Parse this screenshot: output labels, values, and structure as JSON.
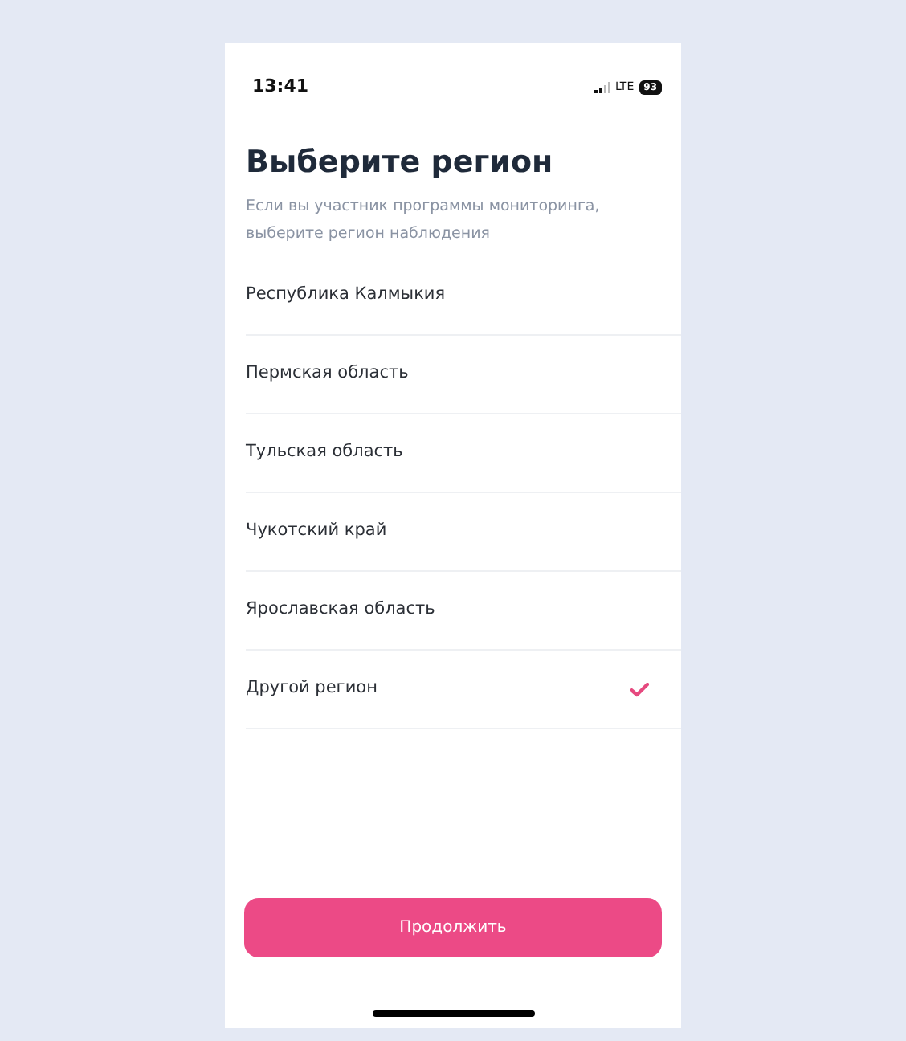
{
  "status_bar": {
    "time": "13:41",
    "network": "LTE",
    "battery": "93"
  },
  "title": "Выберите регион",
  "subtitle": "Если вы участник программы мониторинга, выберите регион наблюдения",
  "regions": [
    {
      "label": "Республика Калмыкия",
      "selected": false
    },
    {
      "label": "Пермская область",
      "selected": false
    },
    {
      "label": "Тульская область",
      "selected": false
    },
    {
      "label": "Чукотский край",
      "selected": false
    },
    {
      "label": "Ярославская область",
      "selected": false
    },
    {
      "label": "Другой регион",
      "selected": true
    }
  ],
  "continue_button": "Продолжить"
}
